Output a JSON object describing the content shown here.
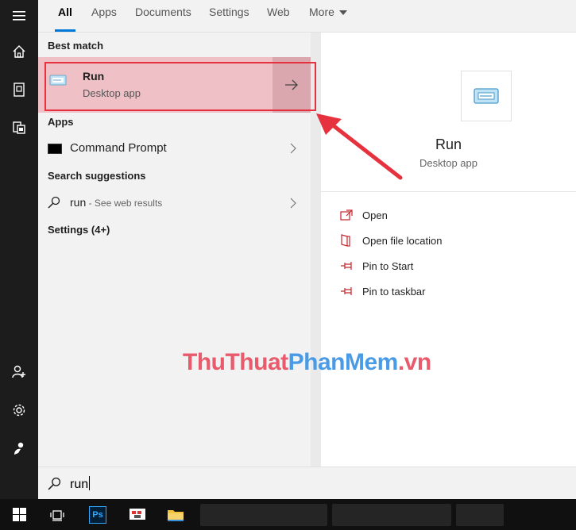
{
  "tabs": [
    {
      "label": "All"
    },
    {
      "label": "Apps"
    },
    {
      "label": "Documents"
    },
    {
      "label": "Settings"
    },
    {
      "label": "Web"
    },
    {
      "label": "More"
    }
  ],
  "sections": {
    "best_match": "Best match",
    "apps": "Apps",
    "search_suggestions": "Search suggestions",
    "settings": "Settings (4+)"
  },
  "best_match": {
    "title": "Run",
    "subtitle": "Desktop app"
  },
  "apps_items": [
    {
      "label": "Command Prompt"
    }
  ],
  "suggestion": {
    "query": "run",
    "suffix": " - See web results"
  },
  "detail": {
    "title": "Run",
    "subtitle": "Desktop app",
    "actions": [
      {
        "label": "Open",
        "icon": "open-icon"
      },
      {
        "label": "Open file location",
        "icon": "file-location-icon"
      },
      {
        "label": "Pin to Start",
        "icon": "pin-icon"
      },
      {
        "label": "Pin to taskbar",
        "icon": "pin-icon"
      }
    ]
  },
  "search": {
    "value": "run"
  },
  "taskbar": {
    "ps_label": "Ps"
  },
  "watermark": {
    "part1": "ThuThuat",
    "part2": "PhanMem",
    "part3": ".vn"
  },
  "colors": {
    "accent": "#0078d7",
    "highlight": "#efc1c6",
    "annotation": "#e6323e"
  }
}
